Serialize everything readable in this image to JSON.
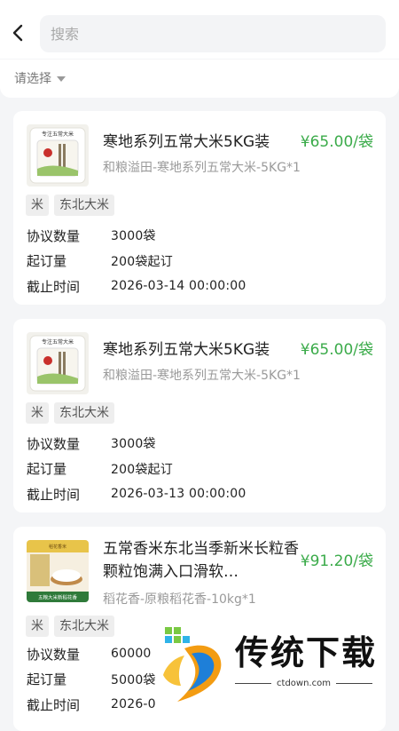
{
  "search": {
    "placeholder": "搜索"
  },
  "filter": {
    "label": "请选择"
  },
  "products": [
    {
      "title": "寒地系列五常大米5KG装",
      "price": "¥65.00/袋",
      "subtitle": "和粮溢田-寒地系列五常大米-5KG*1",
      "tags": [
        "米",
        "东北大米"
      ],
      "rows": [
        {
          "label": "协议数量",
          "value": "3000袋"
        },
        {
          "label": "起订量",
          "value": "200袋起订"
        },
        {
          "label": "截止时间",
          "value": "2026-03-14 00:00:00"
        }
      ],
      "thumb_text": "专注五常大米"
    },
    {
      "title": "寒地系列五常大米5KG装",
      "price": "¥65.00/袋",
      "subtitle": "和粮溢田-寒地系列五常大米-5KG*1",
      "tags": [
        "米",
        "东北大米"
      ],
      "rows": [
        {
          "label": "协议数量",
          "value": "3000袋"
        },
        {
          "label": "起订量",
          "value": "200袋起订"
        },
        {
          "label": "截止时间",
          "value": "2026-03-13 00:00:00"
        }
      ],
      "thumb_text": "专注五常大米"
    },
    {
      "title": "五常香米东北当季新米长粒香颗粒饱满入口滑软…",
      "price": "¥91.20/袋",
      "subtitle": "稻花香-原粮稻花香-10kg*1",
      "tags": [
        "米",
        "东北大米"
      ],
      "rows": [
        {
          "label": "协议数量",
          "value": "60000"
        },
        {
          "label": "起订量",
          "value": "5000袋"
        },
        {
          "label": "截止时间",
          "value": "2026-0"
        }
      ],
      "thumb_text": "五粮大米新稻花香"
    }
  ],
  "watermark": {
    "name": "传统下载",
    "url": "ctdown.com"
  },
  "colors": {
    "price": "#3bab4a",
    "background": "#f4f5f7"
  }
}
